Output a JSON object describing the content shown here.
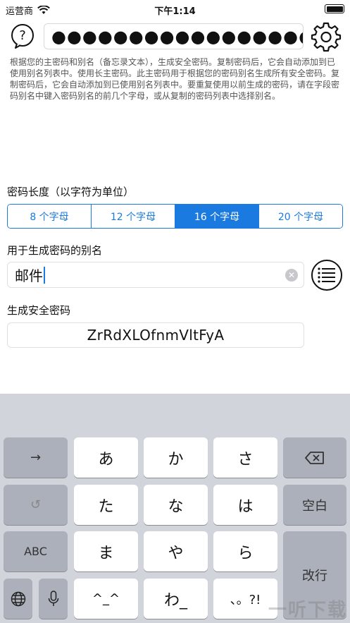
{
  "status_bar": {
    "carrier": "运营商",
    "time": "下午1:14"
  },
  "header": {
    "master_password_mask": "●●●●●●●●●●●●●●●●●●●●"
  },
  "description": "根据您的主密码和别名（备忘录文本），生成安全密码。复制密码后，它会自动添加到已使用别名列表中。使用长主密码。此主密码用于根据您的密码别名生成所有安全密码。复制密码后，它会自动添加到已使用别名列表中。要重复使用以前生成的密码，请在字段密码别名中键入密码别名的前几个字母，或从复制的密码列表中选择别名。",
  "length_section": {
    "label": "密码长度（以字符为单位）",
    "options": [
      "8 个字母",
      "12 个字母",
      "16 个字母",
      "20 个字母"
    ],
    "selected_index": 2
  },
  "alias_section": {
    "label": "用于生成密码的别名",
    "value": "邮件"
  },
  "generated_section": {
    "label": "生成安全密码",
    "value": "ZrRdXLOfnmVltFyA"
  },
  "keyboard": {
    "row1": [
      "→",
      "あ",
      "か",
      "さ",
      "⌫"
    ],
    "row2": [
      "↺",
      "た",
      "な",
      "は",
      "空白"
    ],
    "row3": [
      "ABC",
      "ま",
      "や",
      "ら",
      "改行"
    ],
    "row4": [
      "🌐",
      "🎤",
      "^_^",
      "わ_",
      "、。?!"
    ]
  },
  "watermark": "一听下载"
}
